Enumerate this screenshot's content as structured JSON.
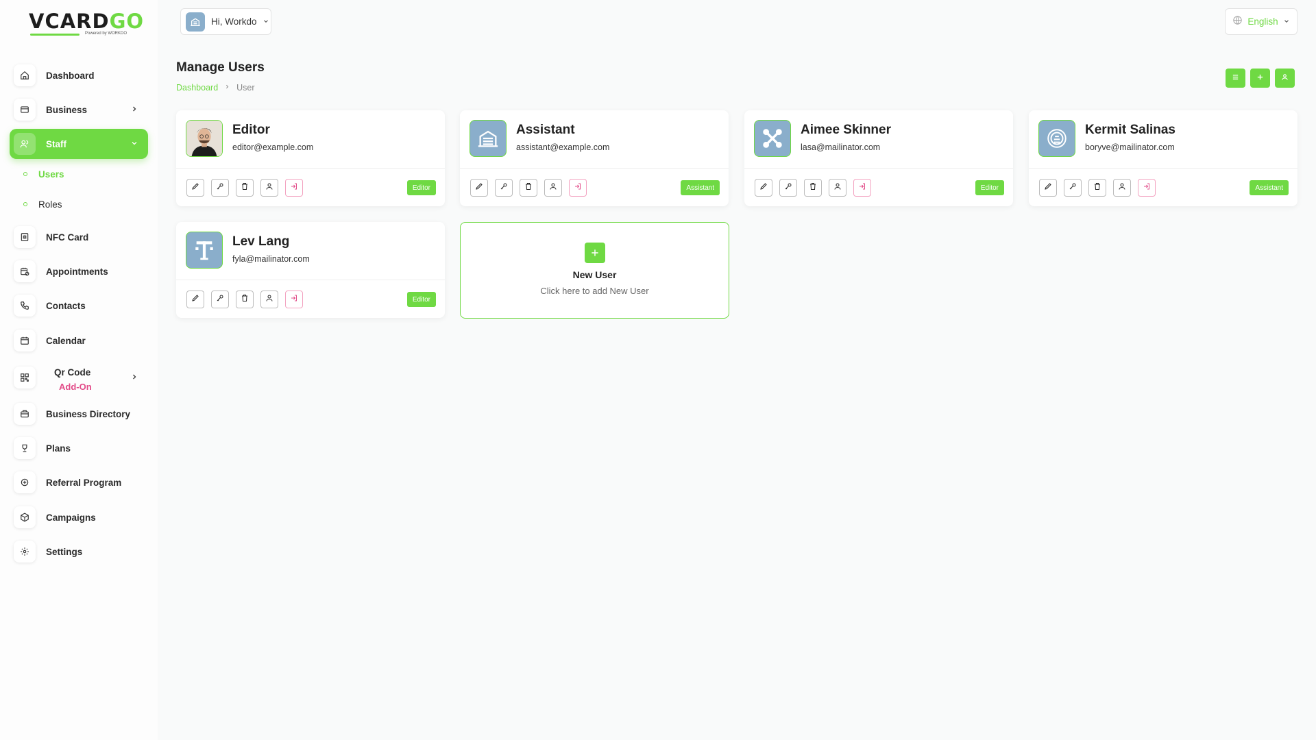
{
  "brand": {
    "logo_main": "VCARD",
    "logo_accent": "GO",
    "logo_sub": "Powered by WORKDO"
  },
  "header": {
    "greeting": "Hi, Workdo",
    "language": "English"
  },
  "sidebar": {
    "items": [
      {
        "label": "Dashboard",
        "icon": "home-icon"
      },
      {
        "label": "Business",
        "icon": "business-card-icon"
      },
      {
        "label": "Staff",
        "icon": "users-icon"
      },
      {
        "label": "NFC Card",
        "icon": "nfc-icon"
      },
      {
        "label": "Appointments",
        "icon": "calendar-clock-icon"
      },
      {
        "label": "Contacts",
        "icon": "phone-icon"
      },
      {
        "label": "Calendar",
        "icon": "calendar-icon"
      },
      {
        "label": "Qr Code",
        "icon": "qr-code-icon",
        "badge": "Add-On"
      },
      {
        "label": "Business Directory",
        "icon": "briefcase-icon"
      },
      {
        "label": "Plans",
        "icon": "trophy-icon"
      },
      {
        "label": "Referral Program",
        "icon": "referral-icon"
      },
      {
        "label": "Campaigns",
        "icon": "box-icon"
      },
      {
        "label": "Settings",
        "icon": "gear-icon"
      }
    ],
    "staff_sub": [
      {
        "label": "Users"
      },
      {
        "label": "Roles"
      }
    ]
  },
  "page": {
    "title": "Manage Users",
    "breadcrumb": [
      "Dashboard",
      "User"
    ]
  },
  "users": [
    {
      "name": "Editor",
      "email": "editor@example.com",
      "role": "Editor",
      "avatar": "photo"
    },
    {
      "name": "Assistant",
      "email": "assistant@example.com",
      "role": "Assistant",
      "avatar": "building"
    },
    {
      "name": "Aimee Skinner",
      "email": "lasa@mailinator.com",
      "role": "Editor",
      "avatar": "joomla"
    },
    {
      "name": "Kermit Salinas",
      "email": "boryve@mailinator.com",
      "role": "Assistant",
      "avatar": "seal"
    },
    {
      "name": "Lev Lang",
      "email": "fyla@mailinator.com",
      "role": "Editor",
      "avatar": "t-logo"
    }
  ],
  "new_user": {
    "title": "New User",
    "subtitle": "Click here to add New User"
  },
  "colors": {
    "accent": "#6fd943",
    "login_pink": "#e24b88",
    "avatar_bg": "#8aaecb"
  }
}
